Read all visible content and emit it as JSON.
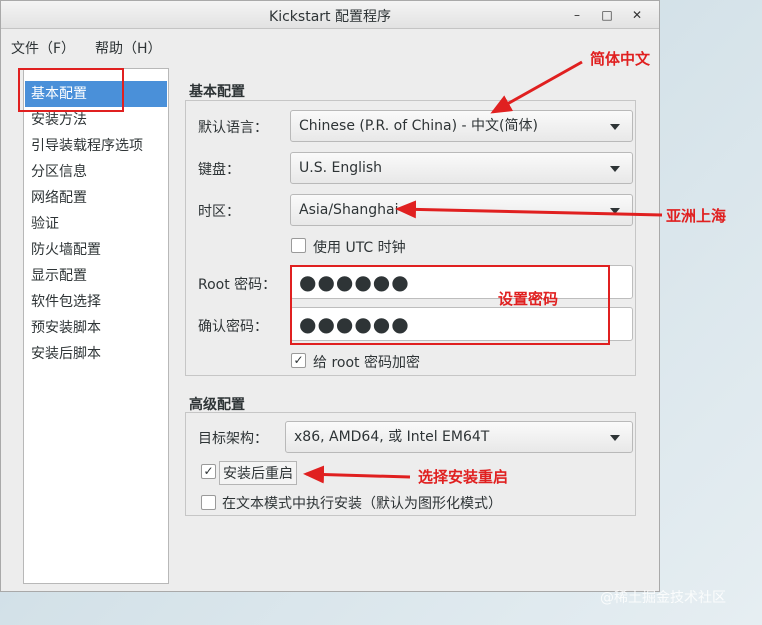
{
  "window": {
    "title": "Kickstart 配置程序",
    "controls": {
      "minimize": "–",
      "maximize": "□",
      "close": "✕"
    }
  },
  "menu": {
    "file": "文件（F）",
    "help": "帮助（H）"
  },
  "nav": {
    "items": [
      "基本配置",
      "安装方法",
      "引导装载程序选项",
      "分区信息",
      "网络配置",
      "验证",
      "防火墙配置",
      "显示配置",
      "软件包选择",
      "预安装脚本",
      "安装后脚本"
    ],
    "selected": 0
  },
  "basic": {
    "title": "基本配置",
    "language_label": "默认语言：",
    "language_value": "Chinese (P.R. of China) - 中文(简体)",
    "keyboard_label": "键盘：",
    "keyboard_value": "U.S. English",
    "timezone_label": "时区：",
    "timezone_value": "Asia/Shanghai",
    "utc_label": "使用  UTC 时钟",
    "utc_checked": false,
    "root_pw_label": "Root 密码：",
    "root_pw_value": "●●●●●●",
    "confirm_pw_label": "确认密码：",
    "confirm_pw_value": "●●●●●●",
    "encrypt_label": "给  root 密码加密",
    "encrypt_checked": true
  },
  "advanced": {
    "title": "高级配置",
    "arch_label": "目标架构：",
    "arch_value": "x86, AMD64, 或  Intel EM64T",
    "reboot_label": "安装后重启",
    "reboot_checked": true,
    "textmode_label": "在文本模式中执行安装（默认为图形化模式）",
    "textmode_checked": false
  },
  "annotations": {
    "simplified_chinese": "简体中文",
    "asia_shanghai": "亚洲上海",
    "set_password": "设置密码",
    "select_reboot": "选择安装重启",
    "color": "#e02020"
  },
  "watermark": "@稀土掘金技术社区"
}
